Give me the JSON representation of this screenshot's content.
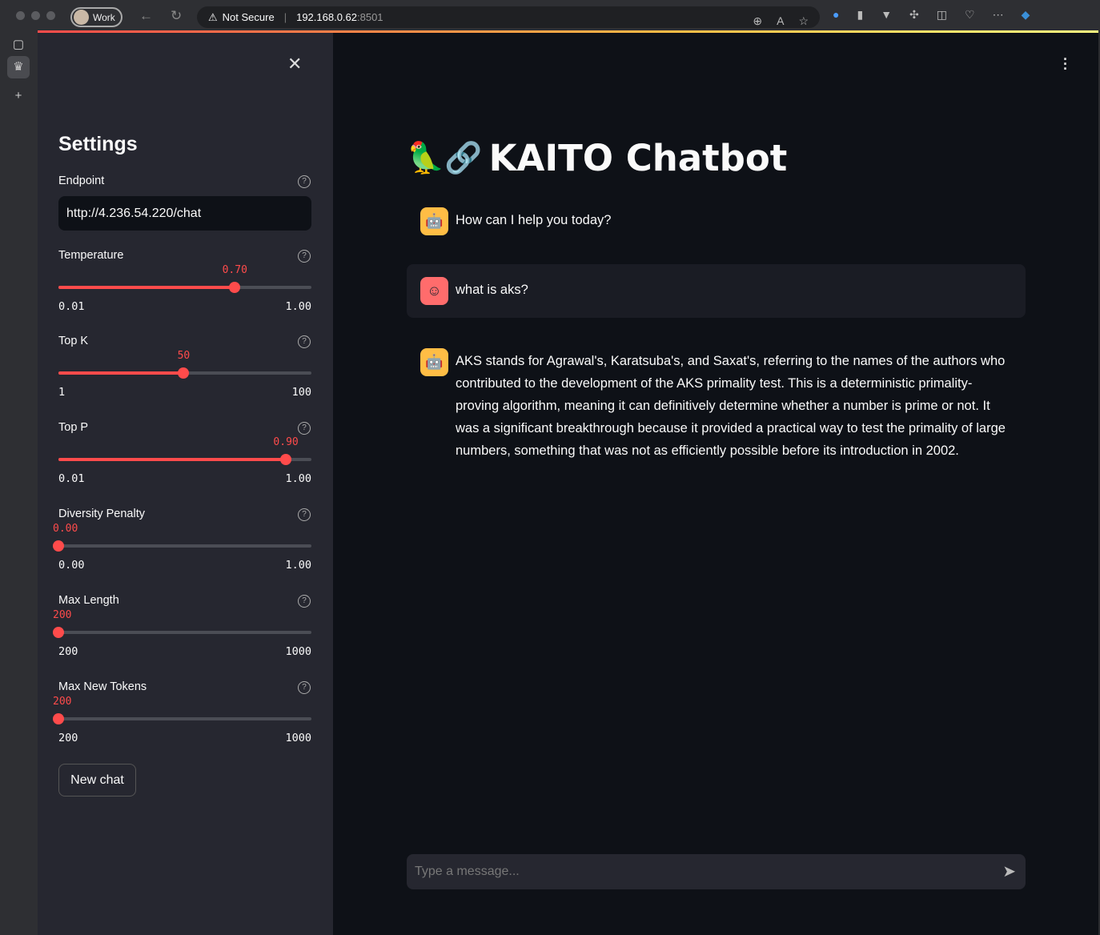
{
  "browser": {
    "profile": "Work",
    "security": "Not Secure",
    "url_host": "192.168.0.62",
    "url_port": ":8501"
  },
  "sidebar": {
    "title": "Settings",
    "endpoint": {
      "label": "Endpoint",
      "value": "http://4.236.54.220/chat"
    },
    "sliders": [
      {
        "label": "Temperature",
        "value": "0.70",
        "min": "0.01",
        "max": "1.00",
        "fraction": 0.697
      },
      {
        "label": "Top K",
        "value": "50",
        "min": "1",
        "max": "100",
        "fraction": 0.495
      },
      {
        "label": "Top P",
        "value": "0.90",
        "min": "0.01",
        "max": "1.00",
        "fraction": 0.899
      },
      {
        "label": "Diversity Penalty",
        "value": "0.00",
        "min": "0.00",
        "max": "1.00",
        "fraction": 0
      },
      {
        "label": "Max Length",
        "value": "200",
        "min": "200",
        "max": "1000",
        "fraction": 0
      },
      {
        "label": "Max New Tokens",
        "value": "200",
        "min": "200",
        "max": "1000",
        "fraction": 0
      }
    ],
    "new_chat": "New chat"
  },
  "main": {
    "title_emoji": "🦜🔗",
    "title": "KAITO Chatbot",
    "messages": [
      {
        "role": "assistant",
        "text": "How can I help you today?"
      },
      {
        "role": "user",
        "text": "what is aks?"
      },
      {
        "role": "assistant",
        "text": "AKS stands for Agrawal's, Karatsuba's, and Saxat's, referring to the names of the authors who contributed to the development of the AKS primality test. This is a deterministic primality-proving algorithm, meaning it can definitively determine whether a number is prime or not. It was a significant breakthrough because it provided a practical way to test the primality of large numbers, something that was not as efficiently possible before its introduction in 2002."
      }
    ],
    "input_placeholder": "Type a message...",
    "colors": {
      "accent": "#ff4b4b",
      "bot": "#ffbd45",
      "user": "#ff6c6c"
    }
  }
}
